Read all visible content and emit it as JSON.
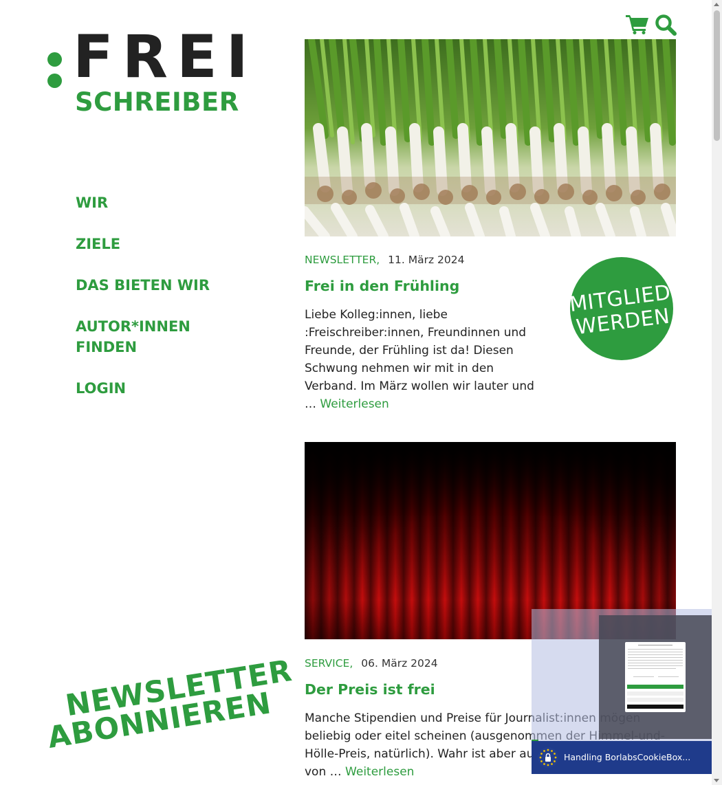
{
  "logo": {
    "top": "FREI",
    "bottom": "SCHREIBER"
  },
  "header": {
    "cart_icon": "shopping-cart-icon",
    "search_icon": "search-icon"
  },
  "nav": [
    {
      "label": "WIR"
    },
    {
      "label": "ZIELE"
    },
    {
      "label": "DAS BIETEN WIR"
    },
    {
      "label": "AUTOR*INNEN FINDEN"
    },
    {
      "label": "LOGIN"
    }
  ],
  "posts": [
    {
      "category": "NEWSLETTER,",
      "date": "11. März 2024",
      "title": "Frei in den Frühling",
      "excerpt": "Liebe Kolleg:innen, liebe :Freischreiber:innen, Freundinnen und Freunde, der Frühling ist da! Diesen Schwung nehmen wir mit in den Verband. Im März wollen wir lauter und …",
      "readmore": "Weiterlesen"
    },
    {
      "category": "SERVICE,",
      "date": "06. März 2024",
      "title": "Der Preis ist frei",
      "excerpt": "Manche Stipendien und Preise für Journalist:innen mögen beliebig oder eitel scheinen (ausgenommen der Himmel-und-Hölle-Preis, natürlich). Wahr ist aber auch: Die klamme Kasse von …",
      "readmore": "Weiterlesen"
    }
  ],
  "badge": {
    "line1": "MITGLIED",
    "line2": "WERDEN"
  },
  "newsletter": {
    "line1": "NEWSLETTER",
    "line2": "ABONNIEREN"
  },
  "cookie": {
    "bar_text": "Handling BorlabsCookieBox..."
  },
  "colors": {
    "brand_green": "#2e9c3f",
    "logo_dark": "#222222",
    "cookie_blue": "#1f3b8b"
  }
}
